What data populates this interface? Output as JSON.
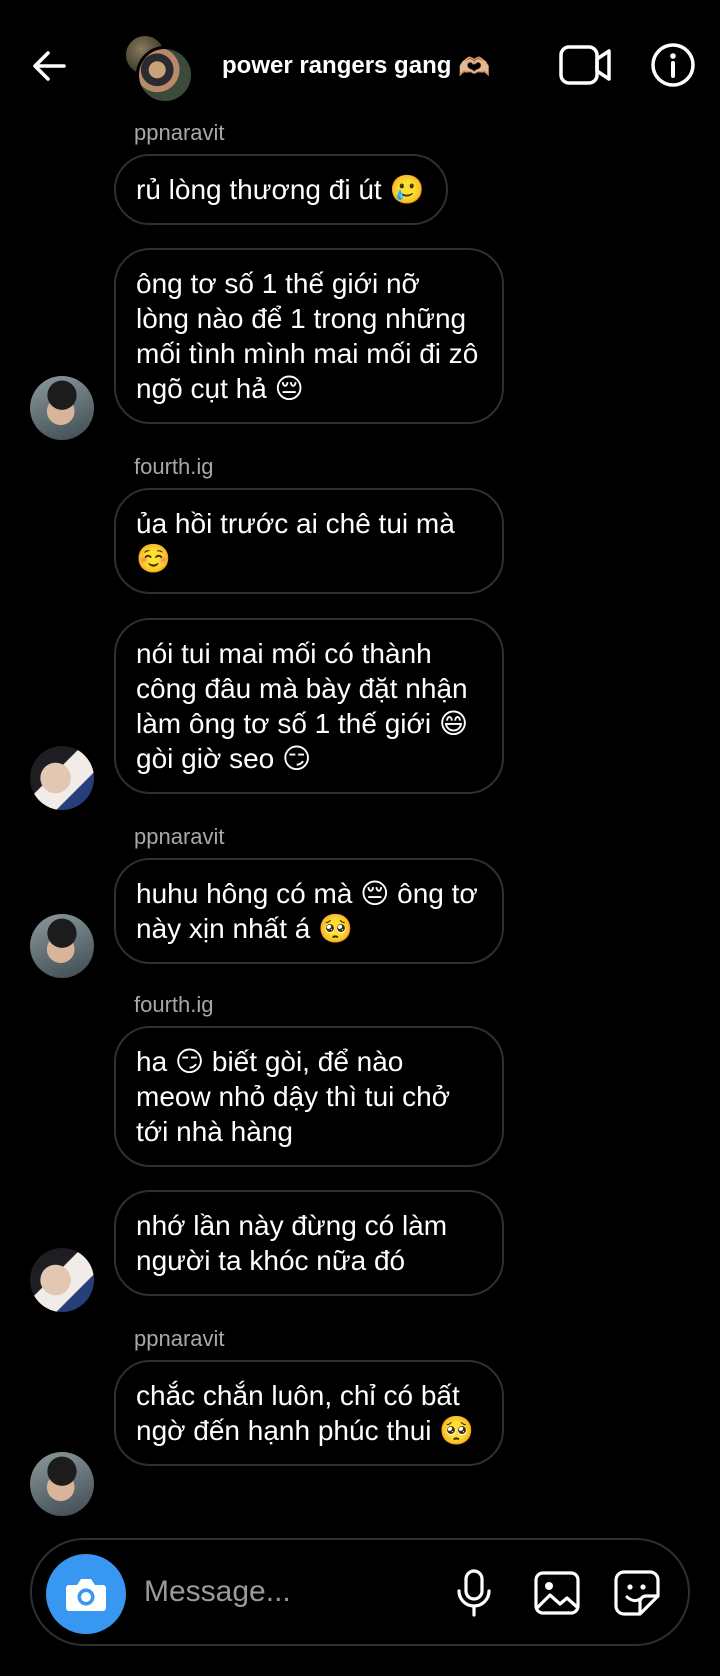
{
  "header": {
    "title": "power rangers gang",
    "title_emoji": "🫶🏼",
    "icons": {
      "back": "arrow-left-icon",
      "video": "video-camera-icon",
      "info": "info-icon"
    }
  },
  "messages": [
    {
      "sender": "ppnaravit",
      "text": "rủ lòng thương đi út 🥲"
    },
    {
      "sender": "",
      "text": "ông tơ số 1 thế giới nỡ lòng nào để 1 trong những mối tình mình mai mối đi zô ngõ cụt hả 😔"
    },
    {
      "sender": "fourth.ig",
      "text": "ủa hồi trước ai chê tui mà ☺️"
    },
    {
      "sender": "",
      "text": "nói tui mai mối có thành công đâu mà bày đặt nhận làm ông tơ số 1 thế giới 😄 gòi giờ seo 😏"
    },
    {
      "sender": "ppnaravit",
      "text": "huhu hông có mà 😔 ông tơ này xịn nhất á 🥺"
    },
    {
      "sender": "fourth.ig",
      "text": "ha 😏 biết gòi, để nào meow nhỏ dậy thì tui chở tới nhà hàng"
    },
    {
      "sender": "",
      "text": "nhớ lần này đừng có làm người ta khóc nữa đó"
    },
    {
      "sender": "ppnaravit",
      "text": "chắc chắn luôn, chỉ có bất ngờ đến hạnh phúc thui 🥺"
    }
  ],
  "composer": {
    "placeholder": "Message...",
    "icons": {
      "camera": "camera-icon",
      "mic": "microphone-icon",
      "gallery": "image-gallery-icon",
      "sticker": "sticker-icon"
    },
    "accent": "#3897f0"
  }
}
